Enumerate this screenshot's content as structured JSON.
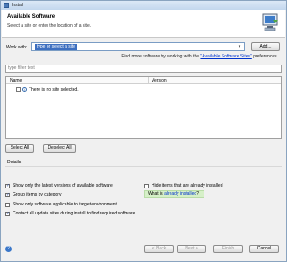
{
  "window": {
    "title": "Install"
  },
  "banner": {
    "heading": "Available Software",
    "subheading": "Select a site or enter the location of a site."
  },
  "workwith": {
    "label": "Work with:",
    "value": "type or select a site",
    "add_label": "Add..."
  },
  "find_more": {
    "prefix": "Find more software by working with the ",
    "link": "\"Available Software Sites\"",
    "suffix": " preferences."
  },
  "filter": {
    "placeholder": "type filter text"
  },
  "table": {
    "columns": [
      "Name",
      "Version"
    ],
    "rows": [
      {
        "name": "There is no site selected."
      }
    ]
  },
  "selection_buttons": {
    "select_all": "Select All",
    "deselect_all": "Deselect All"
  },
  "details": {
    "label": "Details"
  },
  "options": [
    {
      "label": "Show only the latest versions of available software",
      "checked": true
    },
    {
      "label": "Group items by category",
      "checked": true
    },
    {
      "label": "Show only software applicable to target environment",
      "checked": false
    },
    {
      "label": "Contact all update sites during install to find required software",
      "checked": true
    },
    {
      "label": "Hide items that are already installed",
      "checked": false
    }
  ],
  "installed_info": {
    "prefix": "What is ",
    "link": "already installed",
    "suffix": "?"
  },
  "footer": {
    "help_icon": "?",
    "back": "< Back",
    "next": "Next >",
    "finish": "Finish",
    "cancel": "Cancel"
  }
}
